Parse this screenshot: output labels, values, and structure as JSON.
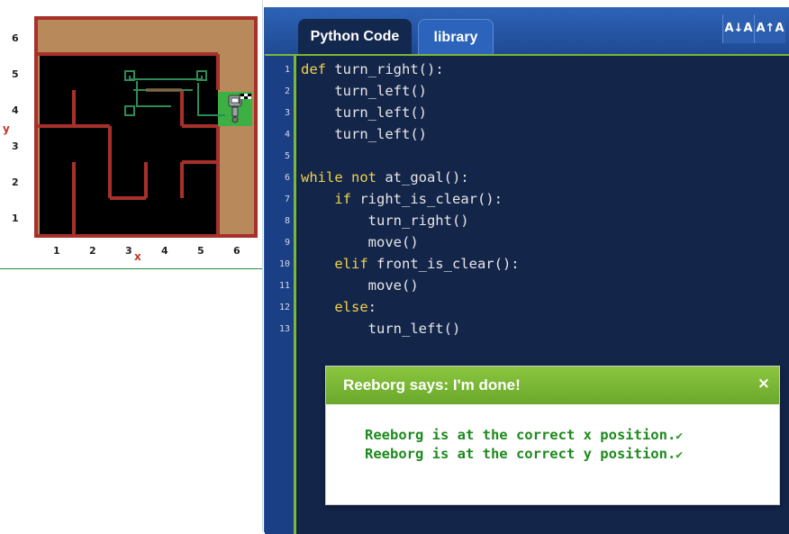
{
  "world": {
    "y_axis_letter": "y",
    "x_axis_letter": "x",
    "y_labels": [
      "6",
      "5",
      "4",
      "3",
      "2",
      "1"
    ],
    "x_labels": [
      "1",
      "2",
      "3",
      "4",
      "5",
      "6"
    ],
    "colors": {
      "dirt": "#b8895a",
      "wall": "#a8302a",
      "floor": "#000000",
      "trace": "#2e8b57",
      "goal": "#3cb043"
    },
    "robot_icon": "robot-icon",
    "goal_icon": "checkered-flag-icon"
  },
  "editor": {
    "tabs": [
      {
        "label": "Python Code",
        "active": true
      },
      {
        "label": "library",
        "active": false
      }
    ],
    "font_decrease_label": "A↓A",
    "font_increase_label": "A↑A",
    "line_numbers": [
      "1",
      "2",
      "3",
      "4",
      "5",
      "6",
      "7",
      "8",
      "9",
      "10",
      "11",
      "12",
      "13"
    ],
    "code": [
      "def turn_right():",
      "    turn_left()",
      "    turn_left()",
      "    turn_left()",
      "",
      "while not at_goal():",
      "    if right_is_clear():",
      "        turn_right()",
      "        move()",
      "    elif front_is_clear():",
      "        move()",
      "    else:",
      "        turn_left()"
    ]
  },
  "dialog": {
    "title": "Reeborg says: I'm done!",
    "close_label": "×",
    "messages": [
      "Reeborg is at the correct x position.",
      "Reeborg is at the correct y position."
    ],
    "check_glyph": "✔"
  }
}
